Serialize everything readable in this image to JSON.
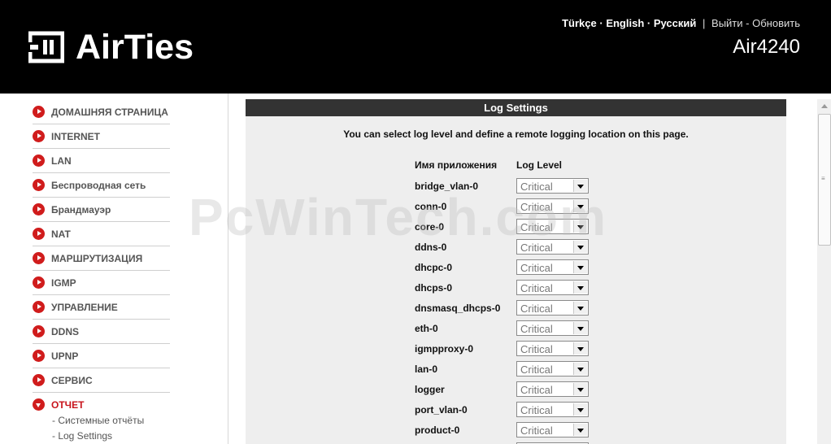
{
  "header": {
    "brand": "AirTies",
    "model": "Air4240",
    "languages": [
      "Türkçe",
      "English",
      "Русский"
    ],
    "separator": "|",
    "logout": "Выйти",
    "refresh": "Обновить",
    "dash": "-",
    "lang_sep": "·"
  },
  "sidebar": {
    "items": [
      {
        "label": "ДОМАШНЯЯ СТРАНИЦА"
      },
      {
        "label": "INTERNET"
      },
      {
        "label": "LAN"
      },
      {
        "label": "Беспроводная сеть"
      },
      {
        "label": "Брандмауэр"
      },
      {
        "label": "NAT"
      },
      {
        "label": "МАРШРУТИЗАЦИЯ"
      },
      {
        "label": "IGMP"
      },
      {
        "label": "УПРАВЛЕНИЕ"
      },
      {
        "label": "DDNS"
      },
      {
        "label": "UPNP"
      },
      {
        "label": "СЕРВИС"
      },
      {
        "label": "ОТЧЕТ"
      }
    ],
    "subitems": [
      {
        "label": "- Системные отчёты"
      },
      {
        "label": "- Log Settings"
      }
    ]
  },
  "panel": {
    "title": "Log Settings",
    "description": "You can select log level and define a remote logging location on this page.",
    "col_app": "Имя приложения",
    "col_level": "Log Level",
    "rows": [
      {
        "name": "bridge_vlan-0",
        "level": "Critical"
      },
      {
        "name": "conn-0",
        "level": "Critical"
      },
      {
        "name": "core-0",
        "level": "Critical"
      },
      {
        "name": "ddns-0",
        "level": "Critical"
      },
      {
        "name": "dhcpc-0",
        "level": "Critical"
      },
      {
        "name": "dhcps-0",
        "level": "Critical"
      },
      {
        "name": "dnsmasq_dhcps-0",
        "level": "Critical"
      },
      {
        "name": "eth-0",
        "level": "Critical"
      },
      {
        "name": "igmpproxy-0",
        "level": "Critical"
      },
      {
        "name": "lan-0",
        "level": "Critical"
      },
      {
        "name": "logger",
        "level": "Critical"
      },
      {
        "name": "port_vlan-0",
        "level": "Critical"
      },
      {
        "name": "product-0",
        "level": "Critical"
      }
    ]
  },
  "watermark": "PcWinTech.com",
  "colors": {
    "accent": "#d01c1c",
    "header_bg": "#000000",
    "panel_title_bg": "#333333"
  }
}
